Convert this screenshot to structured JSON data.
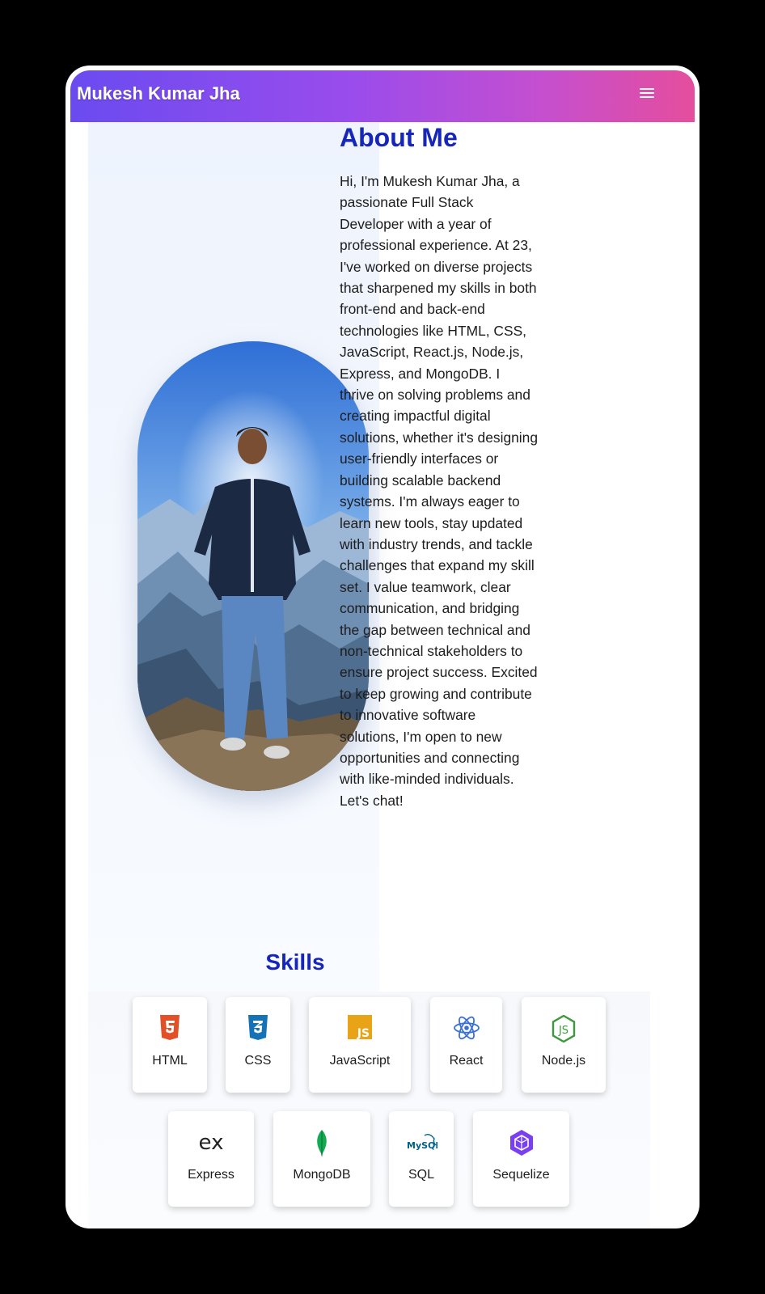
{
  "navbar": {
    "brand": "Mukesh Kumar Jha",
    "menu_icon": "hamburger-menu-icon"
  },
  "about": {
    "title": "About Me",
    "photo": "profile-photo",
    "paragraph": "Hi, I'm Mukesh Kumar Jha, a passionate Full Stack Developer with a year of professional experience. At 23, I've worked on diverse projects that sharpened my skills in both front-end and back-end technologies like HTML, CSS, JavaScript, React.js, Node.js, Express, and MongoDB. I thrive on solving problems and creating impactful digital solutions, whether it's designing user-friendly interfaces or building scalable backend systems. I'm always eager to learn new tools, stay updated with industry trends, and tackle challenges that expand my skill set. I value teamwork, clear communication, and bridging the gap between technical and non-technical stakeholders to ensure project success. Excited to keep growing and contribute to innovative software solutions, I'm open to new opportunities and connecting with like-minded individuals. Let's chat!"
  },
  "skills": {
    "title": "Skills",
    "items": [
      {
        "label": "HTML",
        "icon": "html5-icon",
        "color": "#e34f26"
      },
      {
        "label": "CSS",
        "icon": "css3-icon",
        "color": "#1572b6"
      },
      {
        "label": "JavaScript",
        "icon": "javascript-icon",
        "color": "#e8a317"
      },
      {
        "label": "React",
        "icon": "react-icon",
        "color": "#3a6fd8"
      },
      {
        "label": "Node.js",
        "icon": "nodejs-icon",
        "color": "#3c9a3c"
      },
      {
        "label": "Express",
        "icon": "express-icon",
        "color": "#222222"
      },
      {
        "label": "MongoDB",
        "icon": "mongodb-leaf-icon",
        "color": "#13aa52"
      },
      {
        "label": "SQL",
        "icon": "mysql-icon",
        "color": "#00618a"
      },
      {
        "label": "Sequelize",
        "icon": "sequelize-icon",
        "color": "#7b3ff2"
      }
    ]
  },
  "colors": {
    "accent": "#1626b8",
    "nav_gradient_start": "#6a4bf0",
    "nav_gradient_end": "#e54e9d"
  }
}
